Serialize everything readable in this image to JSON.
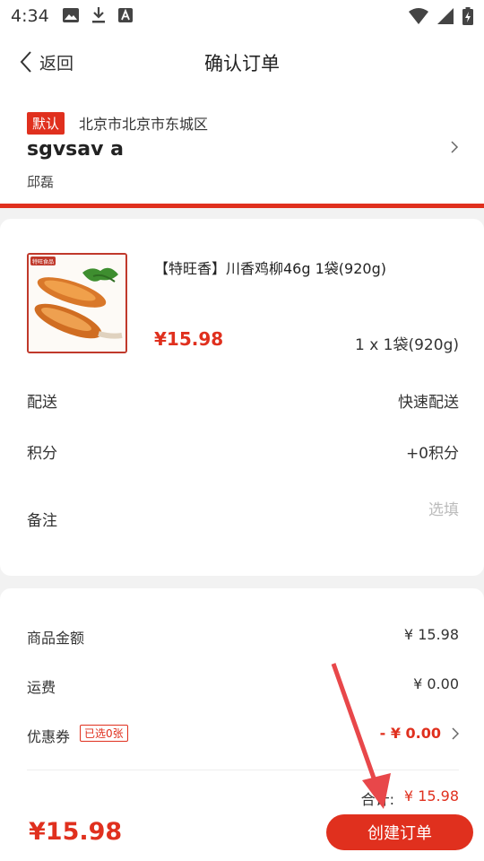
{
  "status_bar": {
    "time": "4:34",
    "left_icons": [
      "image-icon",
      "download-icon",
      "font-icon"
    ],
    "right_icons": [
      "wifi-icon",
      "signal-icon",
      "battery-icon"
    ]
  },
  "nav": {
    "back_label": "返回",
    "title": "确认订单"
  },
  "address": {
    "badge": "默认",
    "region": "北京市北京市东城区",
    "name": "sgvsav a",
    "phone": "邱磊",
    "stripe_color": "#e0301e"
  },
  "product": {
    "thumb_brand": "特旺食品",
    "title": "【特旺香】川香鸡柳46g 1袋(920g)",
    "price": "¥15.98",
    "quantity": "1 x 1袋(920g)"
  },
  "order_options": {
    "delivery_label": "配送",
    "delivery_value": "快速配送",
    "points_label": "积分",
    "points_value": "+0积分",
    "remark_label": "备注",
    "remark_placeholder": "选填"
  },
  "summary": {
    "goods_label": "商品金额",
    "goods_value": "¥ 15.98",
    "shipping_label": "运费",
    "shipping_value": "¥ 0.00",
    "coupon_label": "优惠券",
    "coupon_tag": "已选0张",
    "coupon_value": "- ¥ 0.00",
    "total_label": "合计:",
    "total_value": "¥ 15.98"
  },
  "bottom_bar": {
    "price": "¥15.98",
    "submit_label": "创建订单"
  },
  "colors": {
    "accent": "#e0301e",
    "annotation_arrow": "#e8474a"
  }
}
